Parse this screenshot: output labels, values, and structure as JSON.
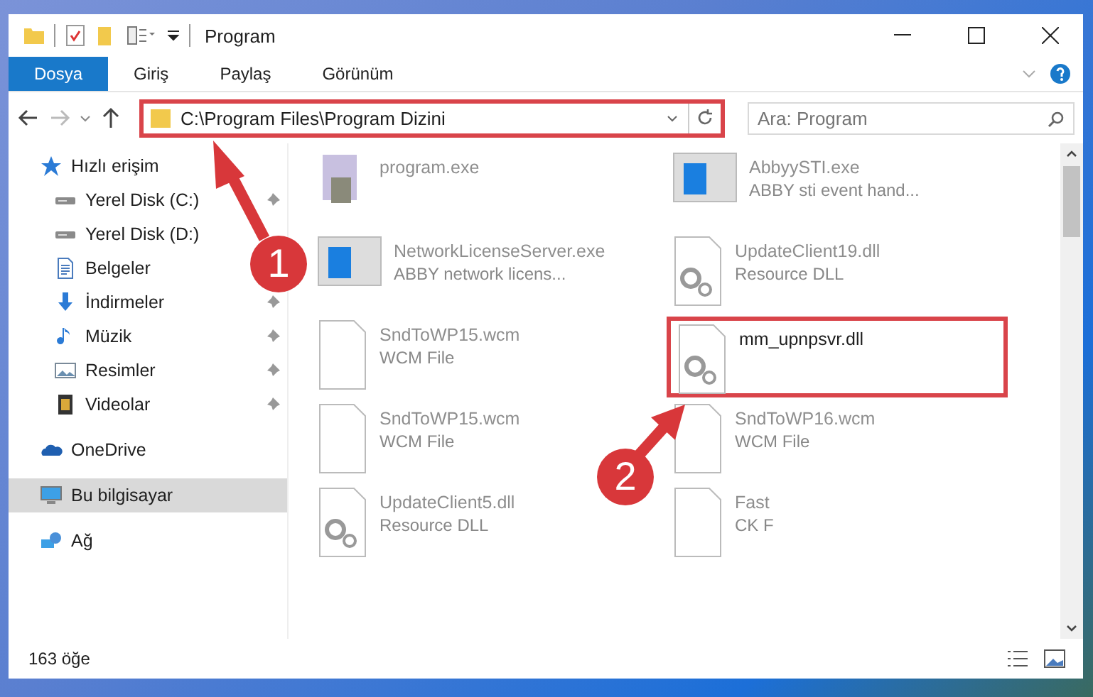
{
  "window": {
    "title": "Program"
  },
  "ribbon_tabs": [
    {
      "label": "Dosya",
      "selected": true
    },
    {
      "label": "Giriş",
      "selected": false
    },
    {
      "label": "Paylaş",
      "selected": false
    },
    {
      "label": "Görünüm",
      "selected": false
    }
  ],
  "address": {
    "path": "C:\\Program Files\\Program Dizini",
    "highlighted": true
  },
  "search": {
    "placeholder": "Ara: Program"
  },
  "sidebar": {
    "items": [
      {
        "label": "Hızlı erişim",
        "kind": "star",
        "selected": false,
        "children": [
          {
            "label": "Yerel Disk (C:)",
            "kind": "drive",
            "pinned": true,
            "selected": false
          },
          {
            "label": "Yerel Disk (D:)",
            "kind": "drive",
            "pinned": false,
            "selected": false
          },
          {
            "label": "Belgeler",
            "kind": "document",
            "pinned": false,
            "selected": false
          },
          {
            "label": "İndirmeler",
            "kind": "download",
            "pinned": true,
            "selected": false
          },
          {
            "label": "Müzik",
            "kind": "music",
            "pinned": true,
            "selected": false
          },
          {
            "label": "Resimler",
            "kind": "pictures",
            "pinned": true,
            "selected": false
          },
          {
            "label": "Videolar",
            "kind": "video",
            "pinned": true,
            "selected": false
          }
        ]
      },
      {
        "label": "OneDrive",
        "kind": "cloud",
        "selected": false
      },
      {
        "label": "Bu bilgisayar",
        "kind": "computer",
        "selected": true
      },
      {
        "label": "Ağ",
        "kind": "network",
        "selected": false
      }
    ]
  },
  "files": [
    {
      "name": "program.exe",
      "kind": "installer",
      "highlighted": false
    },
    {
      "name": "AbbyySTI.exe",
      "type": "ABBY sti event hand...",
      "kind": "app",
      "highlighted": false
    },
    {
      "name": "NetworkLicenseServer.exe",
      "type": "ABBY network licens...",
      "kind": "app",
      "highlighted": false
    },
    {
      "name": "UpdateClient19.dll",
      "type": "Resource DLL",
      "kind": "dll",
      "highlighted": false
    },
    {
      "name": "SndToWP15.wcm",
      "type": "WCM File",
      "kind": "blank",
      "highlighted": false
    },
    {
      "name": "mm_upnpsvr.dll",
      "kind": "dll",
      "highlighted": true
    },
    {
      "name": "SndToWP15.wcm",
      "type": "WCM File",
      "kind": "blank",
      "highlighted": false
    },
    {
      "name": "SndToWP16.wcm",
      "type": "WCM File",
      "kind": "blank",
      "highlighted": false
    },
    {
      "name": "UpdateClient5.dll",
      "type": "Resource DLL",
      "kind": "dll",
      "highlighted": false
    },
    {
      "name": "Fast",
      "type": "CK F",
      "kind": "blank",
      "highlighted": false
    }
  ],
  "annotations": [
    {
      "number": "1"
    },
    {
      "number": "2"
    }
  ],
  "status_bar": {
    "count": "163 öğe"
  }
}
